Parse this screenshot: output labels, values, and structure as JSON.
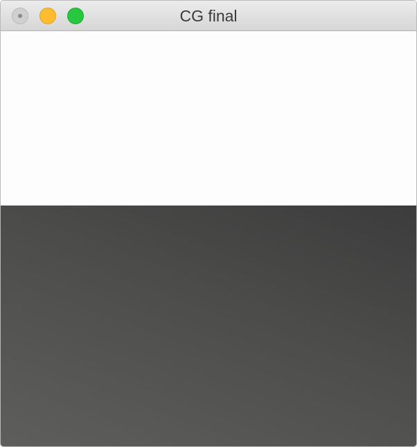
{
  "window": {
    "title": "CG final"
  },
  "traffic_lights": {
    "close_icon": "close-icon",
    "minimize_icon": "minimize-icon",
    "zoom_icon": "zoom-icon",
    "colors": {
      "close": "#d0d0d0",
      "minimize": "#febc2e",
      "zoom": "#27c840"
    }
  },
  "canvas": {
    "top_color": "#fdfdfd",
    "bottom_gradient": [
      "#3c3c3c",
      "#5e5e5d"
    ]
  }
}
